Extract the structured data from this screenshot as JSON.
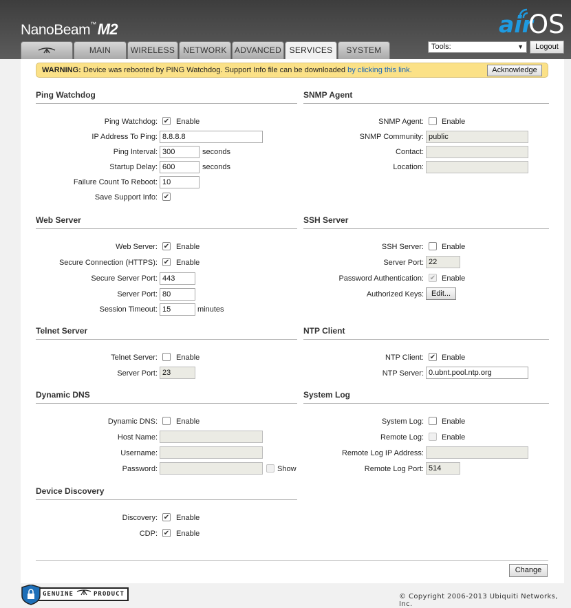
{
  "brand": {
    "name": "NanoBeam",
    "trademark": "™",
    "model": "M2",
    "logo_air": "air",
    "logo_os": "OS"
  },
  "tabs": [
    {
      "label": "",
      "icon": "ubiquiti-logo-icon"
    },
    {
      "label": "MAIN"
    },
    {
      "label": "WIRELESS"
    },
    {
      "label": "NETWORK"
    },
    {
      "label": "ADVANCED"
    },
    {
      "label": "SERVICES",
      "active": true
    },
    {
      "label": "SYSTEM"
    }
  ],
  "tools": {
    "selected": "Tools:",
    "logout_label": "Logout"
  },
  "warning": {
    "prefix": "WARNING:",
    "message": " Device was rebooted by PING Watchdog. Support Info file can be downloaded ",
    "link_text": "by clicking this link.",
    "ack_label": "Acknowledge"
  },
  "ping_watchdog": {
    "title": "Ping Watchdog",
    "enable_label": "Ping Watchdog:",
    "enable_text": "Enable",
    "enabled": true,
    "ip_label": "IP Address To Ping:",
    "ip": "8.8.8.8",
    "interval_label": "Ping Interval:",
    "interval": "300",
    "interval_unit": "seconds",
    "delay_label": "Startup Delay:",
    "delay": "600",
    "delay_unit": "seconds",
    "failure_label": "Failure Count To Reboot:",
    "failure": "10",
    "support_label": "Save Support Info:",
    "support": true
  },
  "snmp": {
    "title": "SNMP Agent",
    "enable_label": "SNMP Agent:",
    "enable_text": "Enable",
    "enabled": false,
    "community_label": "SNMP Community:",
    "community": "public",
    "contact_label": "Contact:",
    "contact": "",
    "location_label": "Location:",
    "location": ""
  },
  "web_server": {
    "title": "Web Server",
    "enable_label": "Web Server:",
    "enable_text": "Enable",
    "enabled": true,
    "https_label": "Secure Connection (HTTPS):",
    "https_text": "Enable",
    "https": true,
    "secure_port_label": "Secure Server Port:",
    "secure_port": "443",
    "port_label": "Server Port:",
    "port": "80",
    "timeout_label": "Session Timeout:",
    "timeout": "15",
    "timeout_unit": "minutes"
  },
  "ssh_server": {
    "title": "SSH Server",
    "enable_label": "SSH Server:",
    "enable_text": "Enable",
    "enabled": false,
    "port_label": "Server Port:",
    "port": "22",
    "password_label": "Password Authentication:",
    "password_text": "Enable",
    "password": true,
    "keys_label": "Authorized Keys:",
    "keys_button": "Edit..."
  },
  "telnet_server": {
    "title": "Telnet Server",
    "enable_label": "Telnet Server:",
    "enable_text": "Enable",
    "enabled": false,
    "port_label": "Server Port:",
    "port": "23"
  },
  "ntp_client": {
    "title": "NTP Client",
    "enable_label": "NTP Client:",
    "enable_text": "Enable",
    "enabled": true,
    "server_label": "NTP Server:",
    "server": "0.ubnt.pool.ntp.org"
  },
  "dynamic_dns": {
    "title": "Dynamic DNS",
    "enable_label": "Dynamic DNS:",
    "enable_text": "Enable",
    "enabled": false,
    "host_label": "Host Name:",
    "host": "",
    "user_label": "Username:",
    "user": "",
    "pass_label": "Password:",
    "pass": "",
    "show_text": "Show",
    "show": false
  },
  "system_log": {
    "title": "System Log",
    "enable_label": "System Log:",
    "enable_text": "Enable",
    "enabled": false,
    "remote_label": "Remote Log:",
    "remote_text": "Enable",
    "remote": false,
    "ip_label": "Remote Log IP Address:",
    "ip": "",
    "port_label": "Remote Log Port:",
    "port": "514"
  },
  "device_discovery": {
    "title": "Device Discovery",
    "discovery_label": "Discovery:",
    "discovery_text": "Enable",
    "discovery": true,
    "cdp_label": "CDP:",
    "cdp_text": "Enable",
    "cdp": true
  },
  "change_label": "Change",
  "footer": {
    "badge_left": "GENUINE",
    "badge_right": "PRODUCT",
    "copyright": "© Copyright 2006-2013 Ubiquiti Networks, Inc."
  },
  "colors": {
    "accent": "#1e9ae0",
    "warning_bg": "#fbe187",
    "link": "#1a66b9"
  }
}
